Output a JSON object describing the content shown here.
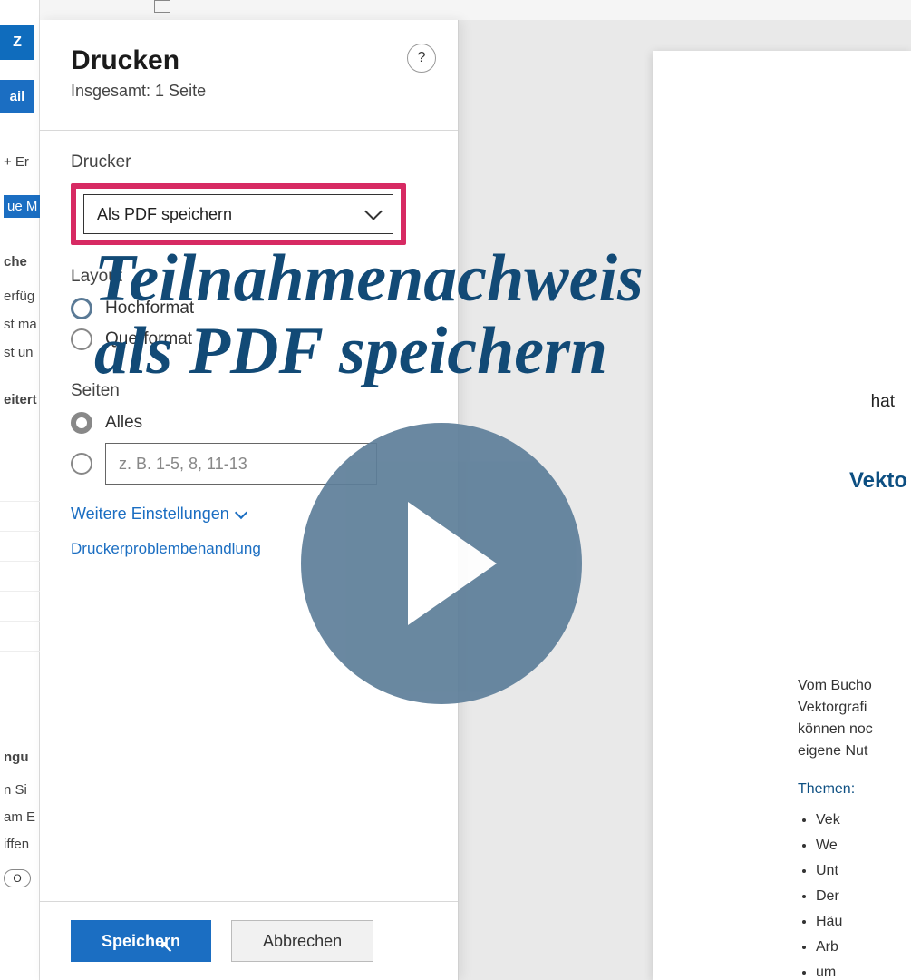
{
  "print_dialog": {
    "title": "Drucken",
    "subtitle": "Insgesamt: 1 Seite",
    "help_tooltip": "?",
    "printer_label": "Drucker",
    "printer_value": "Als PDF speichern",
    "layout_label": "Layout",
    "layout_options": {
      "portrait": "Hochformat",
      "landscape": "Querformat"
    },
    "pages_label": "Seiten",
    "pages_all": "Alles",
    "pages_range_placeholder": "z. B. 1-5, 8, 11-13",
    "more_settings": "Weitere Einstellungen",
    "troubleshoot": "Druckerproblembehandlung",
    "save_btn": "Speichern",
    "cancel_btn": "Abbrechen"
  },
  "left_strip": {
    "logo": "Z",
    "tab": "ail",
    "er": "+ Er",
    "nm": "ue M",
    "che": "che",
    "erf": "erfüg",
    "stm": "st ma",
    "stu": "st un",
    "eit": "eitert",
    "ngu": "ngu",
    "nsi": "n Si",
    "ame": "am E",
    "iff": "iffen",
    "pill": "O"
  },
  "overlay": {
    "line1": "Teilnahmenachweis",
    "line2": "als PDF speichern"
  },
  "preview": {
    "hat": "hat",
    "title": "Vekto",
    "p1": "Vom Bucho",
    "p2": "Vektorgrafi",
    "p3": "können noc",
    "p4": "eigene Nut",
    "themen": "Themen:",
    "bullets": [
      "Vek",
      "We",
      "Unt",
      "Der",
      "Häu",
      "Arb",
      "um"
    ]
  }
}
